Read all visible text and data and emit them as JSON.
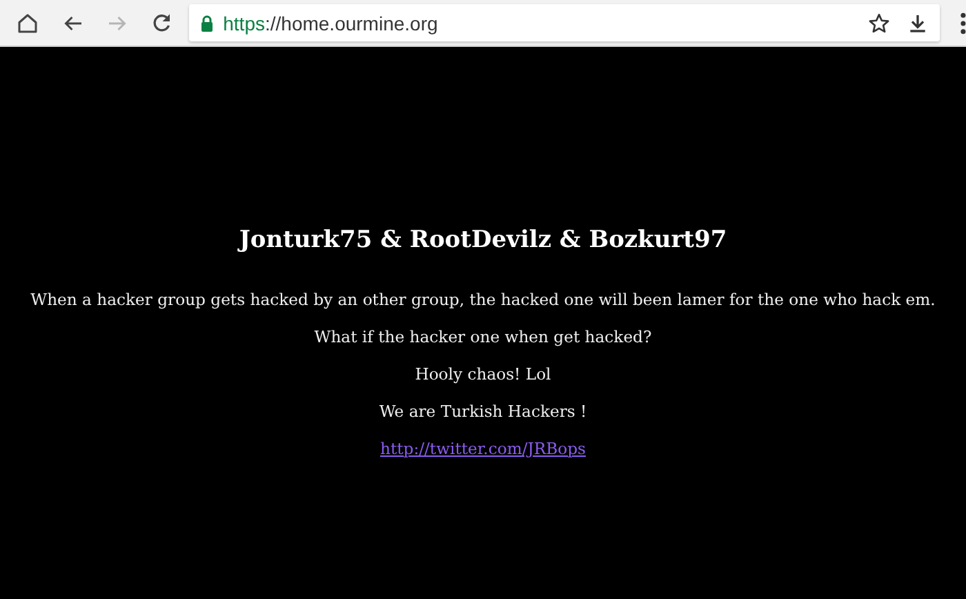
{
  "toolbar": {
    "buttons": [
      {
        "kind": "home",
        "disabled": false
      },
      {
        "kind": "back",
        "disabled": false
      },
      {
        "kind": "forward",
        "disabled": true
      },
      {
        "kind": "reload",
        "disabled": false
      }
    ],
    "address": {
      "secure": true,
      "scheme": "https",
      "rest": "://home.ourmine.org"
    },
    "actions": [
      {
        "kind": "star"
      },
      {
        "kind": "download"
      },
      {
        "kind": "menu"
      }
    ]
  },
  "page": {
    "heading": "Jonturk75 & RootDevilz & Bozkurt97",
    "paragraphs": [
      {
        "kind": "text",
        "text": "When a hacker group gets hacked by an other group, the hacked one will been lamer for the one who hack em."
      },
      {
        "kind": "text",
        "text": "What if the hacker one when get hacked?"
      },
      {
        "kind": "text",
        "text": "Hooly chaos! Lol"
      },
      {
        "kind": "text",
        "text": "We are Turkish Hackers !"
      },
      {
        "kind": "link",
        "text": "http://twitter.com/JRBops"
      }
    ]
  }
}
